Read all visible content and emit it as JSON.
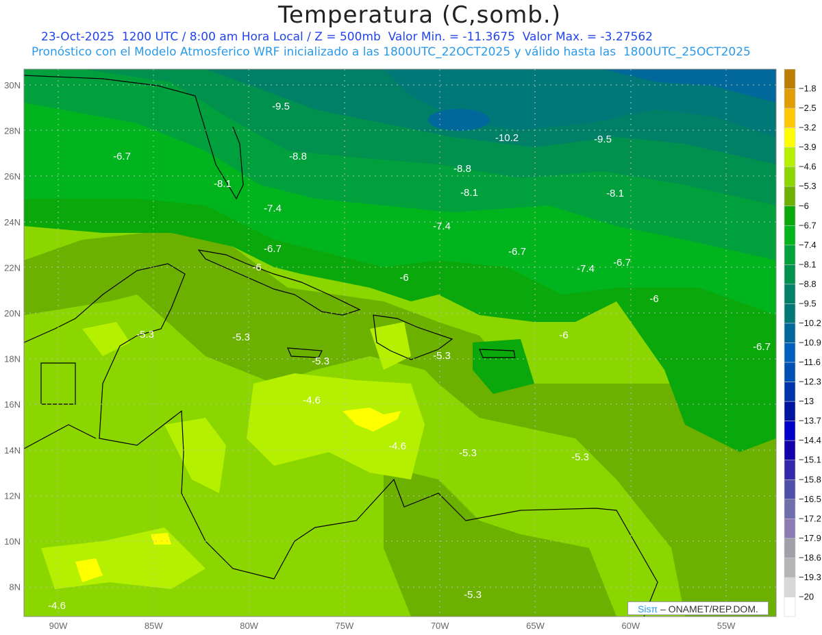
{
  "header": {
    "title": "Temperatura (C,somb.)",
    "line1": "23-Oct-2025  1200 UTC / 8:00 am Hora Local / Z = 500mb  Valor Min. = -11.3675  Valor Max. = -3.27562",
    "line2": "Pronóstico con el Modelo Atmosferico WRF inicializado a las 1800UTC_22OCT2025 y válido hasta las  1800UTC_25OCT2025"
  },
  "axes": {
    "lon_labels": [
      "90W",
      "85W",
      "80W",
      "75W",
      "70W",
      "65W",
      "60W",
      "55W"
    ],
    "lat_labels": [
      "30N",
      "28N",
      "26N",
      "24N",
      "22N",
      "20N",
      "18N",
      "16N",
      "14N",
      "12N",
      "10N",
      "8N"
    ]
  },
  "legend": {
    "labels": [
      "-1.8",
      "-2.5",
      "-3.2",
      "-3.9",
      "-4.6",
      "-5.3",
      "-6",
      "-6.7",
      "-7.4",
      "-8.1",
      "-8.8",
      "-9.5",
      "-10.2",
      "-10.9",
      "-11.6",
      "-12.3",
      "-13",
      "-13.7",
      "-14.4",
      "-15.1",
      "-15.8",
      "-16.5",
      "-17.2",
      "-17.9",
      "-18.6",
      "-19.3",
      "-20"
    ],
    "colors": [
      "#bc7c00",
      "#e09c00",
      "#ffc800",
      "#ffff00",
      "#b4f000",
      "#8cd600",
      "#6cb000",
      "#0aa80a",
      "#00b41e",
      "#00a03c",
      "#00914e",
      "#008066",
      "#007878",
      "#00689a",
      "#0060be",
      "#0050b4",
      "#0032aa",
      "#0014a0",
      "#0000c8",
      "#1400aa",
      "#3228aa",
      "#5050a8",
      "#6e6eaa",
      "#8c7cb4",
      "#a0a0aa",
      "#b4b4b4",
      "#d8d8d8",
      "#ffffff"
    ]
  },
  "contour_labels": [
    "-9.5",
    "-6.7",
    "-8.8",
    "-8.1",
    "-7.4",
    "-6.7",
    "-6",
    "-10.2",
    "-9.5",
    "-8.8",
    "-8.1",
    "-8.1",
    "-7.4",
    "-6.7",
    "-6.7",
    "-7.4",
    "-6",
    "-6",
    "-6",
    "-6.7",
    "-5.3",
    "-5.3",
    "-5.3",
    "-5.3",
    "-4.6",
    "-4.6",
    "-5.3",
    "-5.3",
    "-4.6",
    "-5.3"
  ],
  "credit": {
    "logo": "Sisπ",
    "text": " – ONAMET/REP.DOM."
  }
}
